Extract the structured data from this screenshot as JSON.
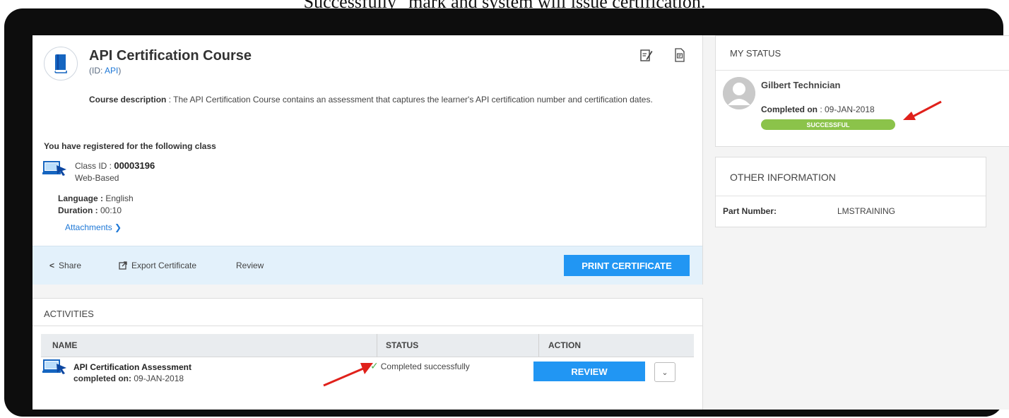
{
  "caption": "Successfully\" mark and system will issue certification.",
  "course": {
    "title": "API Certification Course",
    "id_prefix": "(ID: ",
    "id_value": "API",
    "id_suffix": ")",
    "description_label": "Course description",
    "description_text": " : The API Certification Course contains an assessment that captures the learner's API certification number and certification dates.",
    "header_icons": [
      "edit-note-icon",
      "document-icon"
    ]
  },
  "registration": {
    "heading": "You have registered for the following class",
    "class_id_label": "Class ID : ",
    "class_id_value": "00003196",
    "class_type": "Web-Based",
    "language_label": "Language : ",
    "language_value": "English",
    "duration_label": "Duration : ",
    "duration_value": "00:10",
    "attachments_label": "Attachments",
    "class_icon": "web-based-class-icon"
  },
  "action_bar": {
    "share_label": "Share",
    "export_label": "Export Certificate",
    "review_label": "Review",
    "print_label": "PRINT CERTIFICATE"
  },
  "activities": {
    "title": "ACTIVITIES",
    "columns": [
      "NAME",
      "STATUS",
      "ACTION"
    ],
    "rows": [
      {
        "name": "API Certification Assessment",
        "completed_label": "completed on:",
        "completed_value": "09-JAN-2018",
        "status": "Completed successfully",
        "action_label": "REVIEW"
      }
    ]
  },
  "my_status": {
    "title": "MY STATUS",
    "user_name": "Gilbert Technician",
    "completed_label": "Completed on",
    "completed_value": " : 09-JAN-2018",
    "badge": "SUCCESSFUL"
  },
  "other_info": {
    "title": "OTHER INFORMATION",
    "part_number_label": "Part Number:",
    "part_number_value": "LMSTRAINING"
  },
  "colors": {
    "primary": "#2196f3",
    "success": "#8bc34a",
    "action_bar_bg": "#e3f1fb",
    "annotation_arrow": "#e0211b"
  }
}
